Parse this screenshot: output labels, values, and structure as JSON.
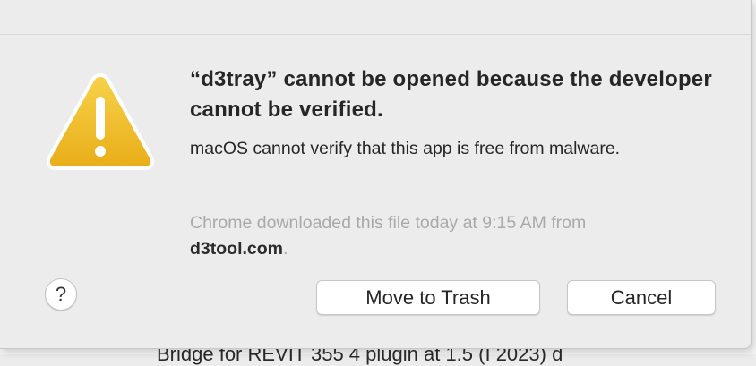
{
  "dialog": {
    "title": "“d3tray” cannot be opened because the developer cannot be verified.",
    "message": "macOS cannot verify that this app is free from malware.",
    "source_prefix": "Chrome downloaded this file today at 9:15 AM from",
    "source_domain": "d3tool.com",
    "source_suffix": ".",
    "help_label": "?",
    "move_to_trash_label": "Move to Trash",
    "cancel_label": "Cancel",
    "icon": "warning-triangle-icon"
  },
  "background": {
    "partial_text": "Bridge for REVIT 355 4 plugin at 1.5 (I 2023) d"
  },
  "colors": {
    "dialog_bg": "#ececec",
    "warning_yellow": "#f2c230",
    "warning_yellow_dark": "#e0a914",
    "text_primary": "#262626",
    "text_secondary": "#a9a9a9"
  }
}
